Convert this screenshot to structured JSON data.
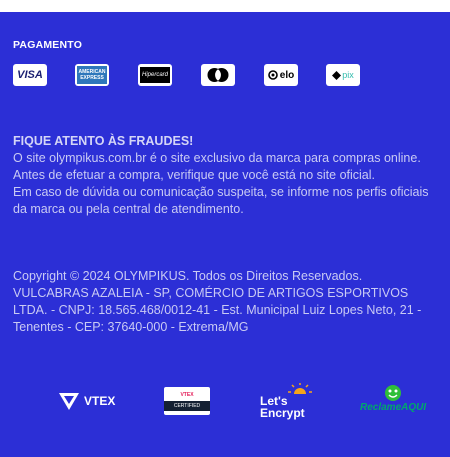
{
  "payment": {
    "title": "PAGAMENTO",
    "methods": [
      {
        "name": "Visa",
        "icon": "visa-icon",
        "label": "VISA"
      },
      {
        "name": "American Express",
        "icon": "amex-icon",
        "label_top": "AMERICAN",
        "label_bottom": "EXPRESS"
      },
      {
        "name": "Hipercard",
        "icon": "hipercard-icon",
        "label": "Hipercard"
      },
      {
        "name": "Mastercard",
        "icon": "mastercard-icon"
      },
      {
        "name": "Elo",
        "icon": "elo-icon",
        "label": "elo"
      },
      {
        "name": "Pix",
        "icon": "pix-icon",
        "label": "pix"
      }
    ]
  },
  "fraud": {
    "title": "FIQUE ATENTO ÀS FRAUDES!",
    "paragraph1": "O site olympikus.com.br é o site exclusivo da marca para compras online. Antes de efetuar a compra, verifique que você está no site oficial.",
    "paragraph2": "Em caso de dúvida ou comunicação suspeita, se informe nos perfis oficiais da marca ou pela central de atendimento."
  },
  "copyright": {
    "line": "Copyright © 2024 OLYMPIKUS. Todos os Direitos Reservados.",
    "company": "VULCABRAS AZALEIA - SP, COMÉRCIO DE ARTIGOS ESPORTIVOS LTDA. - CNPJ: 18.565.468/0012-41 - Est. Municipal Luiz Lopes Neto, 21 - Tenentes - CEP: 37640-000 - Extrema/MG"
  },
  "badges": {
    "vtex": "VTEX",
    "vtex_cert_top": "VTEX",
    "vtex_cert_bottom": "CERTIFIED",
    "lets_encrypt_line1": "Let's",
    "lets_encrypt_line2": "Encrypt",
    "reclame_aqui": "ReclameAQUI"
  },
  "colors": {
    "background": "#2c2fd6",
    "text": "#c9caf4",
    "heading": "#ffffff"
  }
}
